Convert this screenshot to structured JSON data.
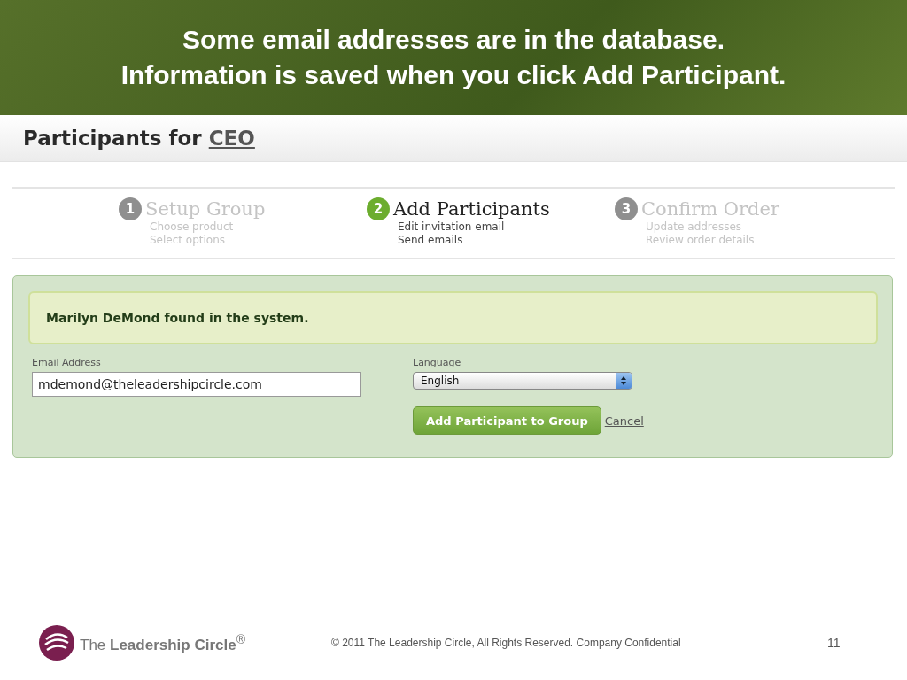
{
  "slide_title": [
    "Some email addresses are in the database.",
    "Information is saved when you click Add Participant."
  ],
  "page_header": {
    "text": "Participants for ",
    "link": "CEO"
  },
  "steps": [
    {
      "number": "1",
      "title": "Setup Group",
      "lines": [
        "Choose product",
        "Select options"
      ],
      "selected": false
    },
    {
      "number": "2",
      "title": "Add Participants",
      "lines": [
        "Edit invitation email",
        "Send emails"
      ],
      "selected": true
    },
    {
      "number": "3",
      "title": "Confirm Order",
      "lines": [
        "Update addresses",
        "Review order details"
      ],
      "selected": false
    }
  ],
  "message": "Marilyn DeMond found in the system.",
  "email": {
    "label": "Email Address",
    "value": "mdemond@theleadershipcircle.com"
  },
  "language": {
    "label": "Language",
    "value": "English"
  },
  "submit_button": "Add Participant to Group",
  "cancel_link": "Cancel",
  "footer": {
    "logo_text": "The **Leadership Circle**$^{®}$",
    "copyright": "© 2011 The Leadership Circle, All Rights Reserved. Company Confidential",
    "page_number": "11"
  }
}
